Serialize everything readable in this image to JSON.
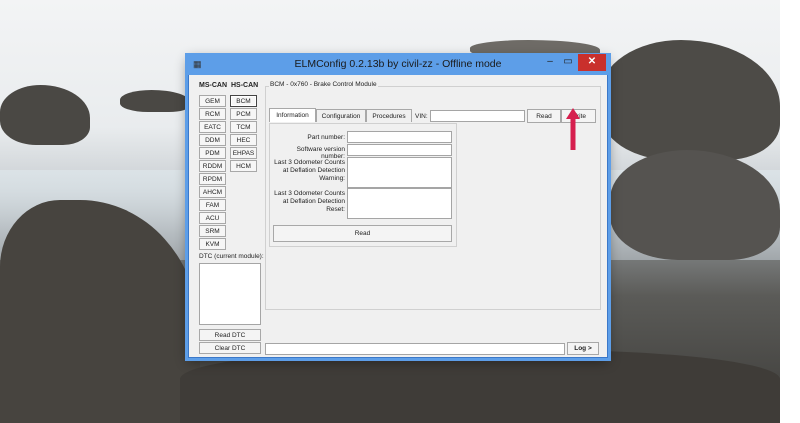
{
  "window": {
    "title": "ELMConfig 0.2.13b by civil-zz - Offline mode",
    "controls": {
      "minimize": "–",
      "maximize": "▭",
      "close": "✕"
    }
  },
  "modules": {
    "ms_can_header": "MS-CAN",
    "hs_can_header": "HS-CAN",
    "ms_can": [
      "GEM",
      "RCM",
      "EATC",
      "DDM",
      "PDM",
      "RDDM",
      "RPDM",
      "AHCM",
      "FAM",
      "ACU",
      "SRM",
      "KVM"
    ],
    "hs_can": [
      "BCM",
      "PCM",
      "TCM",
      "HEC",
      "EHPAS",
      "HCM"
    ],
    "selected": "BCM"
  },
  "dtc": {
    "label": "DTC (current module):",
    "read_label": "Read DTC",
    "clear_label": "Clear DTC"
  },
  "module_panel": {
    "title": "BCM - 0x760 - Brake Control Module",
    "tabs": [
      "Information",
      "Configuration",
      "Procedures"
    ],
    "active_tab": "Information",
    "vin_label": "VIN:",
    "vin_value": "",
    "read_label": "Read",
    "write_label": "Write"
  },
  "info": {
    "part_number_label": "Part number:",
    "software_version_label": "Software version number:",
    "odometer_warning_label": "Last 3 Odometer Counts at Deflation Detection Warning:",
    "odometer_reset_label": "Last 3 Odometer Counts at Deflation Detection Reset:",
    "read_label": "Read"
  },
  "log": {
    "button_label": "Log >"
  },
  "colors": {
    "titlebar": "#5d9ee8",
    "close": "#c9302c",
    "annotation_arrow": "#d61f4e"
  }
}
